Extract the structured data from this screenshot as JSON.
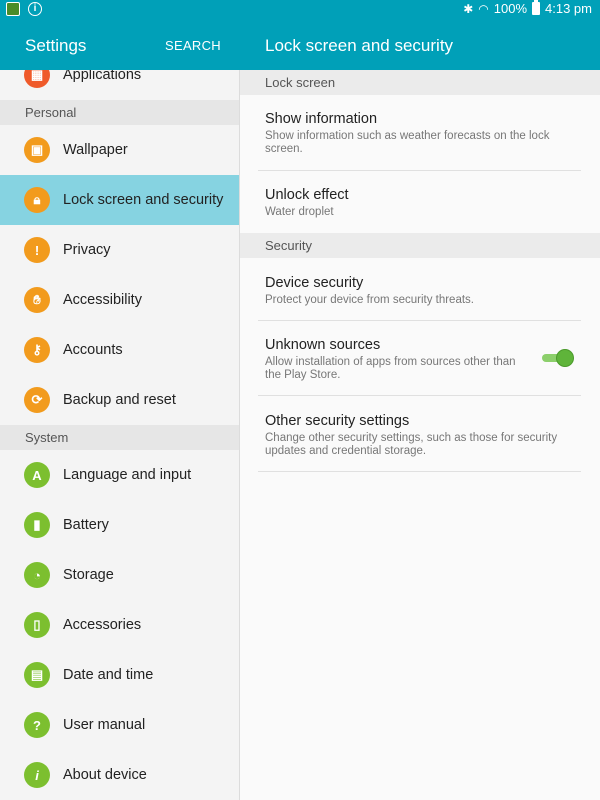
{
  "status_bar": {
    "battery": "100%",
    "time": "4:13 pm"
  },
  "header": {
    "left_title": "Settings",
    "search_label": "SEARCH",
    "right_title": "Lock screen and security"
  },
  "sidebar": {
    "items": [
      {
        "label": "Applications",
        "icon": "apps-icon"
      },
      {
        "label": "Wallpaper",
        "icon": "wallpaper-icon"
      },
      {
        "label": "Lock screen and security",
        "icon": "lock-icon"
      },
      {
        "label": "Privacy",
        "icon": "privacy-icon"
      },
      {
        "label": "Accessibility",
        "icon": "hand-icon"
      },
      {
        "label": "Accounts",
        "icon": "key-icon"
      },
      {
        "label": "Backup and reset",
        "icon": "backup-icon"
      },
      {
        "label": "Language and input",
        "icon": "language-icon"
      },
      {
        "label": "Battery",
        "icon": "battery-icon"
      },
      {
        "label": "Storage",
        "icon": "storage-icon"
      },
      {
        "label": "Accessories",
        "icon": "accessories-icon"
      },
      {
        "label": "Date and time",
        "icon": "calendar-icon"
      },
      {
        "label": "User manual",
        "icon": "manual-icon"
      },
      {
        "label": "About device",
        "icon": "info-icon"
      }
    ],
    "sections": {
      "personal": "Personal",
      "system": "System"
    },
    "selected": "Lock screen and security"
  },
  "main": {
    "sections": {
      "lock_screen": "Lock screen",
      "security": "Security"
    },
    "items": [
      {
        "title": "Show information",
        "subtitle": "Show information such as weather forecasts on the lock screen."
      },
      {
        "title": "Unlock effect",
        "subtitle": "Water droplet"
      },
      {
        "title": "Device security",
        "subtitle": "Protect your device from security threats."
      },
      {
        "title": "Unknown sources",
        "subtitle": "Allow installation of apps from sources other than the Play Store."
      },
      {
        "title": "Other security settings",
        "subtitle": "Change other security settings, such as those for security updates and credential storage."
      }
    ],
    "unknown_sources_enabled": true
  },
  "colors": {
    "accent": "#00a0b8",
    "selected": "#86d3e1",
    "toggle_on": "#5fb43a"
  }
}
